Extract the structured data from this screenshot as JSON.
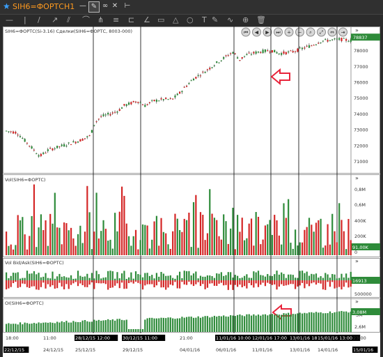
{
  "titlebar": {
    "symbol": "SIH6=ФОРТС",
    "timeframe": "H1"
  },
  "panes": {
    "price": {
      "label": "SIH6=ФОРТС(Si-3.16)  Сделки(SIH6=ФОРТС, 8003-000)",
      "last_value": "78837",
      "y_ticks": [
        "78000",
        "77000",
        "76000",
        "75000",
        "74000",
        "73000",
        "72000",
        "71000"
      ]
    },
    "volume": {
      "label": "Vol(SIH6=ФОРТС)",
      "y_ticks": [
        "0,8M",
        "0,6M",
        "400K",
        "200K",
        "0"
      ],
      "last_value": "91,00K"
    },
    "bidask": {
      "label": "Vol Bid/Ask(SIH6=ФОРТС)",
      "y_ticks": [
        "500000"
      ],
      "last_value": "16913"
    },
    "oi": {
      "label": "OI(SIH6=ФОРТС)",
      "y_ticks": [
        "3M",
        "2,6M"
      ],
      "last_value": "3,08M"
    }
  },
  "xaxis": {
    "top_labels": [
      {
        "text": "18:00",
        "hl": false
      },
      {
        "text": "11:00",
        "hl": false
      },
      {
        "text": "28/12/15 12:00",
        "hl": true
      },
      {
        "text": "30/12/15 11:00",
        "hl": true
      },
      {
        "text": "21:00",
        "hl": false
      },
      {
        "text": "11/01/16 10:00",
        "hl": true
      },
      {
        "text": "12/01/16 17:00",
        "hl": true
      },
      {
        "text": "13/01/16 18:00",
        "hl": true
      },
      {
        "text": "15/01/16 13:00",
        "hl": true
      },
      {
        "text": "23:00",
        "hl": false
      }
    ],
    "bottom_labels": [
      {
        "text": "22/12/15",
        "hl": true
      },
      {
        "text": "24/12/15",
        "hl": false
      },
      {
        "text": "25/12/15",
        "hl": false
      },
      {
        "text": "29/12/15",
        "hl": false
      },
      {
        "text": "04/01/16",
        "hl": false
      },
      {
        "text": "06/01/16",
        "hl": false
      },
      {
        "text": "11/01/16",
        "hl": false
      },
      {
        "text": "13/01/16",
        "hl": false
      },
      {
        "text": "14/01/16",
        "hl": false
      },
      {
        "text": "15/01/16",
        "hl": true
      }
    ]
  },
  "colors": {
    "up": "#2e8b3a",
    "down": "#d42626",
    "arrow": "#e8233a",
    "grid": "#000000",
    "last_badge": "#2e8b3a"
  },
  "icons": [
    "minus-icon",
    "vertical-line-icon",
    "edit-icon",
    "link-icon",
    "tools-icon",
    "settings-icon",
    "pointer-icon",
    "cross-icon",
    "diagonal-line-icon",
    "ray-icon",
    "channel-icon",
    "arc-icon",
    "rectangle-icon",
    "circle-icon",
    "triangle-icon",
    "text-icon",
    "angle-icon",
    "pen-icon",
    "curve-icon",
    "trash-icon",
    "nav-first-icon",
    "nav-prev-icon",
    "nav-play-icon",
    "nav-next-icon",
    "zoom-in-icon",
    "zoom-out-icon",
    "zoom-icon",
    "fit-icon",
    "scroll-left-icon",
    "scroll-right-icon",
    "collapse-icon"
  ]
}
